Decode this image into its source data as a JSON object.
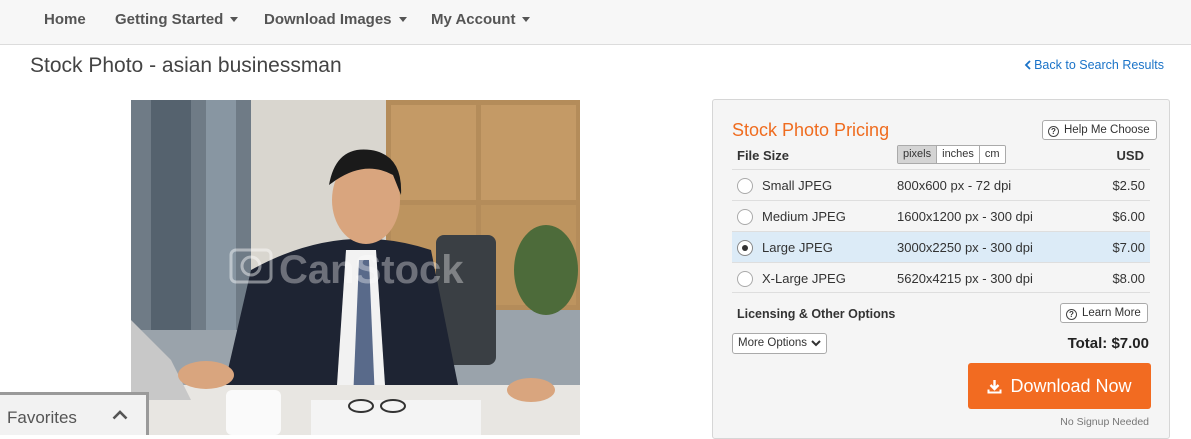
{
  "nav": {
    "items": [
      {
        "label": "Home"
      },
      {
        "label": "Getting Started"
      },
      {
        "label": "Download Images"
      },
      {
        "label": "My Account"
      }
    ]
  },
  "page": {
    "title": "Stock Photo - asian businessman",
    "back_link": "Back to Search Results"
  },
  "photo": {
    "watermark": "CanStock",
    "icon": "camera-icon"
  },
  "favorites": {
    "label": "Favorites",
    "icon": "chevron-up-icon"
  },
  "pricing": {
    "title": "Stock Photo Pricing",
    "help_button": "Help Me Choose",
    "file_size_header": "File Size",
    "currency_header": "USD",
    "units": [
      "pixels",
      "inches",
      "cm"
    ],
    "active_unit": "pixels",
    "rows": [
      {
        "name": "Small JPEG",
        "dims": "800x600 px - 72 dpi",
        "price": "$2.50",
        "selected": false
      },
      {
        "name": "Medium JPEG",
        "dims": "1600x1200 px - 300 dpi",
        "price": "$6.00",
        "selected": false
      },
      {
        "name": "Large JPEG",
        "dims": "3000x2250 px - 300 dpi",
        "price": "$7.00",
        "selected": true
      },
      {
        "name": "X-Large JPEG",
        "dims": "5620x4215 px - 300 dpi",
        "price": "$8.00",
        "selected": false
      }
    ],
    "licensing_header": "Licensing & Other Options",
    "learn_more_button": "Learn More",
    "more_options": "More Options",
    "total": "Total: $7.00",
    "download_button": "Download Now",
    "no_signup": "No Signup Needed"
  },
  "colors": {
    "accent": "#f26b21",
    "link": "#1a73c8",
    "selected_row": "#dcebf7"
  }
}
